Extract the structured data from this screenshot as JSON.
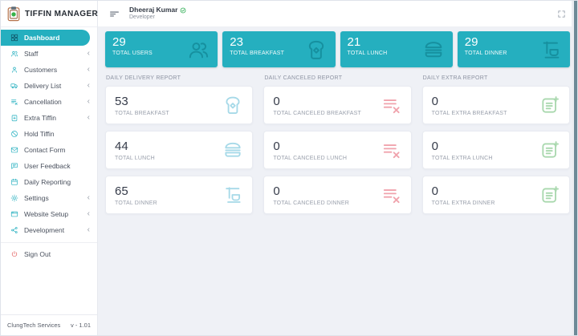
{
  "app": {
    "title": "TIFFIN MANAGER",
    "footer_company": "ClungTech Services",
    "footer_version": "v - 1.01"
  },
  "header": {
    "user_name": "Dheeraj Kumar",
    "user_role": "Developer"
  },
  "sidebar": {
    "items": [
      {
        "label": "Dashboard",
        "icon": "grid-icon",
        "active": true,
        "expandable": false
      },
      {
        "label": "Staff",
        "icon": "people-icon",
        "active": false,
        "expandable": true
      },
      {
        "label": "Customers",
        "icon": "person-icon",
        "active": false,
        "expandable": true
      },
      {
        "label": "Delivery List",
        "icon": "truck-icon",
        "active": false,
        "expandable": true
      },
      {
        "label": "Cancellation",
        "icon": "list-x-icon",
        "active": false,
        "expandable": true
      },
      {
        "label": "Extra Tiffin",
        "icon": "clipboard-plus-icon",
        "active": false,
        "expandable": true
      },
      {
        "label": "Hold Tiffin",
        "icon": "slash-circle-icon",
        "active": false,
        "expandable": false
      },
      {
        "label": "Contact Form",
        "icon": "envelope-icon",
        "active": false,
        "expandable": false
      },
      {
        "label": "User Feedback",
        "icon": "chat-icon",
        "active": false,
        "expandable": false
      },
      {
        "label": "Daily Reporting",
        "icon": "calendar-icon",
        "active": false,
        "expandable": false
      },
      {
        "label": "Settings",
        "icon": "gear-icon",
        "active": false,
        "expandable": true
      },
      {
        "label": "Website Setup",
        "icon": "browser-icon",
        "active": false,
        "expandable": true
      },
      {
        "label": "Development",
        "icon": "nodes-icon",
        "active": false,
        "expandable": true
      },
      {
        "label": "Sign Out",
        "icon": "power-icon",
        "active": false,
        "expandable": false
      }
    ]
  },
  "stats": [
    {
      "value": "29",
      "label": "TOTAL USERS",
      "icon": "users-icon"
    },
    {
      "value": "23",
      "label": "TOTAL BREAKFAST",
      "icon": "toast-icon"
    },
    {
      "value": "21",
      "label": "TOTAL LUNCH",
      "icon": "burger-icon"
    },
    {
      "value": "29",
      "label": "TOTAL DINNER",
      "icon": "dinner-icon"
    }
  ],
  "reports": [
    {
      "title": "DAILY DELIVERY REPORT",
      "cards": [
        {
          "value": "53",
          "label": "TOTAL BREAKFAST",
          "icon": "toast-icon"
        },
        {
          "value": "44",
          "label": "TOTAL LUNCH",
          "icon": "burger-icon"
        },
        {
          "value": "65",
          "label": "TOTAL DINNER",
          "icon": "dinner-icon"
        }
      ]
    },
    {
      "title": "DAILY CANCELED REPORT",
      "cards": [
        {
          "value": "0",
          "label": "TOTAL CANCELED BREAKFAST",
          "icon": "list-x-icon"
        },
        {
          "value": "0",
          "label": "TOTAL CANCELED LUNCH",
          "icon": "list-x-icon"
        },
        {
          "value": "0",
          "label": "TOTAL CANCELED DINNER",
          "icon": "list-x-icon"
        }
      ]
    },
    {
      "title": "DAILY EXTRA REPORT",
      "cards": [
        {
          "value": "0",
          "label": "TOTAL EXTRA BREAKFAST",
          "icon": "list-plus-icon"
        },
        {
          "value": "0",
          "label": "TOTAL EXTRA LUNCH",
          "icon": "list-plus-icon"
        },
        {
          "value": "0",
          "label": "TOTAL EXTRA DINNER",
          "icon": "list-plus-icon"
        }
      ]
    }
  ],
  "colors": {
    "accent": "#25afbf",
    "danger": "#e25c5c",
    "delivery": "#a6d9e8",
    "canceled": "#f0a3ad",
    "extra": "#a9d8ae",
    "badge": "#2fae54"
  }
}
